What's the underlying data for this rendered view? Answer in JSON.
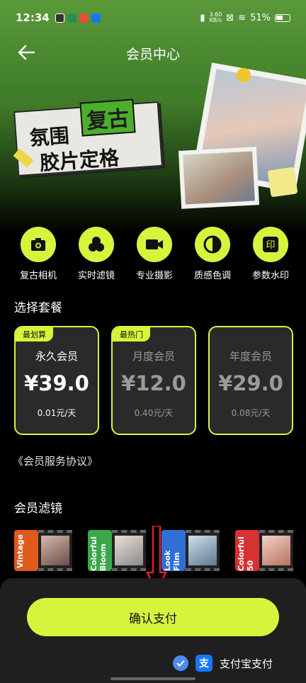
{
  "status": {
    "time": "12:34",
    "speed_top": "3.60",
    "speed_bottom": "KB/s",
    "battery": "51%"
  },
  "header": {
    "title": "会员中心"
  },
  "banner": {
    "line1": "氛围",
    "accent": "复古",
    "line2": "胶片定格"
  },
  "features": [
    {
      "label": "复古相机",
      "icon": "camera-icon"
    },
    {
      "label": "实时滤镜",
      "icon": "filter-icon"
    },
    {
      "label": "专业摄影",
      "icon": "video-icon"
    },
    {
      "label": "质感色调",
      "icon": "tone-icon"
    },
    {
      "label": "参数水印",
      "icon": "watermark-icon"
    }
  ],
  "plans_section": {
    "title": "选择套餐"
  },
  "plans": [
    {
      "tag": "最划算",
      "name": "永久会员",
      "price": "¥39.0",
      "per": "0.01元/天"
    },
    {
      "tag": "最热门",
      "name": "月度会员",
      "price": "¥12.0",
      "per": "0.40元/天"
    },
    {
      "tag": "",
      "name": "年度会员",
      "price": "¥29.0",
      "per": "0.08元/天"
    }
  ],
  "agreement": "《会员服务协议》",
  "filters_section": {
    "title": "会员滤镜"
  },
  "filters": [
    {
      "name": "Vintage",
      "color": "#e05a1e"
    },
    {
      "name": "Colorful Bloom",
      "color": "#3aa84a"
    },
    {
      "name": "Look Film",
      "color": "#2f6fd6"
    },
    {
      "name": "Colorful 50",
      "color": "#d63232"
    }
  ],
  "confirm": {
    "label": "确认支付"
  },
  "payment": {
    "method": "支付宝支付",
    "icon_glyph": "支"
  },
  "colors": {
    "accent": "#d4f53c",
    "alipay": "#1677ff"
  }
}
